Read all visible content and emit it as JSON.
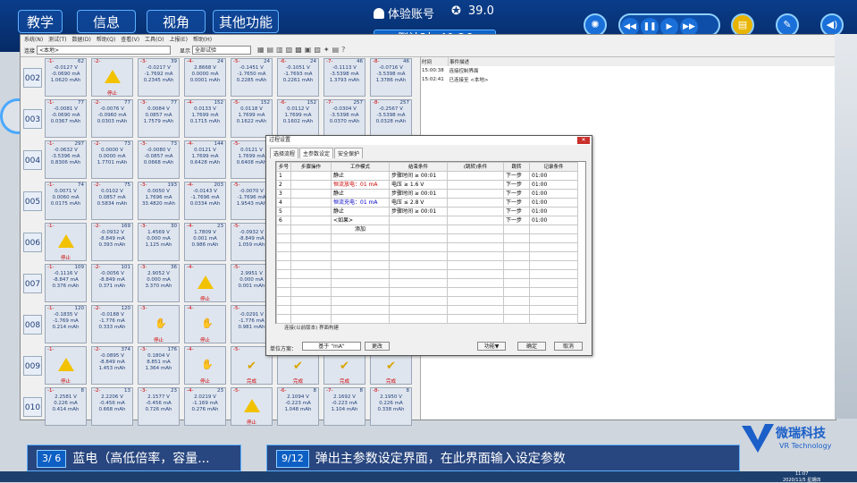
{
  "topbar": {
    "tabs": [
      "教学",
      "信息",
      "视角",
      "其他功能"
    ],
    "account": "体验账号",
    "score": "39.0",
    "timer": "倒计时: 40:26",
    "media": [
      "◀◀",
      "❚❚",
      "▶",
      "▶▶"
    ],
    "buttons": [
      "lightbulb-icon",
      "note-icon",
      "pen-icon",
      "speaker-icon"
    ]
  },
  "app": {
    "menu": [
      "系统(N)",
      "测试(T)",
      "数据(D)",
      "帮助(Q)",
      "查看(V)",
      "工具(O)",
      "上报(E)",
      "帮助(H)"
    ],
    "toolbar": {
      "connect_label": "连接",
      "connect_value": "<本地>",
      "display_label": "显示",
      "display_value": "全部试验"
    },
    "rows": [
      {
        "label": "002",
        "cells": [
          {
            "t": "data",
            "n": "-1-",
            "i": "62",
            "l": [
              "-0.0127 V",
              "-0.0690 mA",
              "1.0620 mAh"
            ]
          },
          {
            "t": "warn",
            "n": "-2-",
            "s": "停止"
          },
          {
            "t": "data",
            "n": "-3-",
            "i": "39",
            "l": [
              "-0.0217 V",
              "-1.7692 mA",
              "0.2345 mAh"
            ]
          },
          {
            "t": "data",
            "n": "-4-",
            "i": "24",
            "l": [
              "2.8668 V",
              "0.0000 mA",
              "0.0001 mAh"
            ]
          },
          {
            "t": "data",
            "n": "-5-",
            "i": "24",
            "l": [
              "-0.1451 V",
              "-1.7650 mA",
              "0.2285 mAh"
            ]
          },
          {
            "t": "data",
            "n": "-6-",
            "i": "24",
            "l": [
              "-0.1051 V",
              "-1.7693 mA",
              "0.2261 mAh"
            ]
          },
          {
            "t": "data",
            "n": "-7-",
            "i": "46",
            "l": [
              "-0.1113 V",
              "-3.5398 mA",
              "1.3793 mAh"
            ]
          },
          {
            "t": "data",
            "n": "-8-",
            "i": "46",
            "l": [
              "-0.0716 V",
              "-3.5398 mA",
              "1.3786 mAh"
            ]
          }
        ]
      },
      {
        "label": "003",
        "cells": [
          {
            "t": "data",
            "n": "-1-",
            "i": "77",
            "l": [
              "-0.0081 V",
              "-0.0690 mA",
              "0.0367 mAh"
            ]
          },
          {
            "t": "data",
            "n": "-2-",
            "i": "77",
            "l": [
              "-0.0076 V",
              "-0.0960 mA",
              "0.0303 mAh"
            ]
          },
          {
            "t": "data",
            "n": "-3-",
            "i": "77",
            "l": [
              "0.0084 V",
              "0.0857 mA",
              "1.7579 mAh"
            ]
          },
          {
            "t": "data",
            "n": "-4-",
            "i": "152",
            "l": [
              "0.0133 V",
              "1.7699 mA",
              "0.1715 mAh"
            ]
          },
          {
            "t": "data",
            "n": "-5-",
            "i": "152",
            "l": [
              "0.0118 V",
              "1.7699 mA",
              "0.1622 mAh"
            ]
          },
          {
            "t": "data",
            "n": "-6-",
            "i": "152",
            "l": [
              "0.0112 V",
              "1.7699 mA",
              "0.1602 mAh"
            ]
          },
          {
            "t": "data",
            "n": "-7-",
            "i": "257",
            "l": [
              "-0.0304 V",
              "-3.5398 mA",
              "0.0370 mAh"
            ]
          },
          {
            "t": "data",
            "n": "-8-",
            "i": "257",
            "l": [
              "-0.2567 V",
              "-3.5398 mA",
              "0.0328 mAh"
            ]
          }
        ]
      },
      {
        "label": "004",
        "cells": [
          {
            "t": "data",
            "n": "-1-",
            "i": "297",
            "l": [
              "-0.0632 V",
              "-3.5396 mA",
              "0.8306 mAh"
            ]
          },
          {
            "t": "data",
            "n": "-2-",
            "i": "73",
            "l": [
              "0.0000 V",
              "0.0000 mA",
              "1.7701 mAh"
            ]
          },
          {
            "t": "data",
            "n": "-3-",
            "i": "73",
            "l": [
              "-0.0080 V",
              "-0.0857 mA",
              "0.0668 mAh"
            ]
          },
          {
            "t": "data",
            "n": "-4-",
            "i": "144",
            "l": [
              "0.0121 V",
              "1.7699 mA",
              "0.6428 mAh"
            ]
          },
          {
            "t": "data",
            "n": "-5-",
            "i": "",
            "l": [
              "0.0121 V",
              "1.7699 mA",
              "0.6408 mAh"
            ]
          }
        ]
      },
      {
        "label": "005",
        "cells": [
          {
            "t": "data",
            "n": "-1-",
            "i": "74",
            "l": [
              "0.0071 V",
              "0.0060 mA",
              "0.0175 mAh"
            ]
          },
          {
            "t": "data",
            "n": "-2-",
            "i": "75",
            "l": [
              "0.0102 V",
              "0.0857 mA",
              "0.5834 mAh"
            ]
          },
          {
            "t": "data",
            "n": "-3-",
            "i": "193",
            "l": [
              "0.0050 V",
              "1.7696 mA",
              "33.4820 mAh"
            ]
          },
          {
            "t": "data",
            "n": "-4-",
            "i": "203",
            "l": [
              "-0.0143 V",
              "-1.7696 mA",
              "0.0334 mAh"
            ]
          },
          {
            "t": "data",
            "n": "-5-",
            "i": "",
            "l": [
              "-0.0070 V",
              "-1.7696 mA",
              "1.9543 mAh"
            ]
          }
        ]
      },
      {
        "label": "006",
        "cells": [
          {
            "t": "warn",
            "n": "-1-",
            "s": "停止"
          },
          {
            "t": "data",
            "n": "-2-",
            "i": "169",
            "l": [
              "-0.0932 V",
              "-8.849 mA",
              "0.393 mAh"
            ]
          },
          {
            "t": "data",
            "n": "-3-",
            "i": "30",
            "l": [
              "1.4569 V",
              "0.000 mA",
              "1.125 mAh"
            ]
          },
          {
            "t": "data",
            "n": "-4-",
            "i": "23",
            "l": [
              "1.7809 V",
              "0.001 mA",
              "0.986 mAh"
            ]
          },
          {
            "t": "data",
            "n": "-5-",
            "i": "",
            "l": [
              "-0.0932 V",
              "-8.849 mA",
              "1.059 mAh"
            ]
          }
        ]
      },
      {
        "label": "007",
        "cells": [
          {
            "t": "data",
            "n": "-1-",
            "i": "109",
            "l": [
              "-0.1116 V",
              "-8.847 mA",
              "0.376 mAh"
            ]
          },
          {
            "t": "data",
            "n": "-2-",
            "i": "101",
            "l": [
              "-0.0056 V",
              "-8.849 mA",
              "0.371 mAh"
            ]
          },
          {
            "t": "data",
            "n": "-3-",
            "i": "36",
            "l": [
              "2.9052 V",
              "0.000 mA",
              "3.370 mAh"
            ]
          },
          {
            "t": "warn",
            "n": "-4-",
            "s": "停止"
          },
          {
            "t": "data",
            "n": "-5-",
            "i": "",
            "l": [
              "2.9951 V",
              "0.000 mA",
              "0.001 mAh"
            ]
          }
        ]
      },
      {
        "label": "008",
        "cells": [
          {
            "t": "data",
            "n": "-1-",
            "i": "120",
            "l": [
              "-0.1835 V",
              "-1.769 mA",
              "0.214 mAh"
            ]
          },
          {
            "t": "data",
            "n": "-2-",
            "i": "120",
            "l": [
              "-0.0188 V",
              "-1.776 mA",
              "0.333 mAh"
            ]
          },
          {
            "t": "hand",
            "n": "-3-",
            "s": "停止"
          },
          {
            "t": "hand",
            "n": "-4-",
            "s": "停止"
          },
          {
            "t": "data",
            "n": "-5-",
            "i": "",
            "l": [
              "-0.0291 V",
              "-1.776 mA",
              "0.981 mAh"
            ]
          }
        ]
      },
      {
        "label": "009",
        "cells": [
          {
            "t": "warn",
            "n": "-1-",
            "s": "停止"
          },
          {
            "t": "data",
            "n": "-2-",
            "i": "374",
            "l": [
              "-0.0895 V",
              "-8.849 mA",
              "1.453 mAh"
            ]
          },
          {
            "t": "data",
            "n": "-3-",
            "i": "176",
            "l": [
              "0.1804 V",
              "8.851 mA",
              "1.364 mAh"
            ]
          },
          {
            "t": "hand",
            "n": "-4-",
            "s": "停止"
          },
          {
            "t": "done",
            "n": "-5-",
            "s": "完成"
          },
          {
            "t": "done",
            "n": "-6-",
            "s": "完成"
          },
          {
            "t": "done",
            "n": "-7-",
            "s": "完成"
          },
          {
            "t": "done",
            "n": "-8-",
            "s": "完成"
          }
        ]
      },
      {
        "label": "010",
        "cells": [
          {
            "t": "data",
            "n": "-1-",
            "i": "8",
            "l": [
              "2.2581 V",
              "0.226 mA",
              "0.414 mAh"
            ]
          },
          {
            "t": "data",
            "n": "-2-",
            "i": "13",
            "l": [
              "2.2206 V",
              "-0.456 mA",
              "0.668 mAh"
            ]
          },
          {
            "t": "data",
            "n": "-3-",
            "i": "23",
            "l": [
              "2.1577 V",
              "-0.456 mA",
              "0.726 mAh"
            ]
          },
          {
            "t": "data",
            "n": "-4-",
            "i": "23",
            "l": [
              "2.0219 V",
              "-1.169 mA",
              "0.276 mAh"
            ]
          },
          {
            "t": "warn",
            "n": "-5-",
            "s": "停止"
          },
          {
            "t": "data",
            "n": "-6-",
            "i": "8",
            "l": [
              "2.1094 V",
              "-0.223 mA",
              "1.048 mAh"
            ]
          },
          {
            "t": "data",
            "n": "-7-",
            "i": "8",
            "l": [
              "2.1692 V",
              "-0.223 mA",
              "1.104 mAh"
            ]
          },
          {
            "t": "data",
            "n": "-8-",
            "i": "8",
            "l": [
              "2.1950 V",
              "0.226 mA",
              "0.338 mAh"
            ]
          }
        ]
      }
    ],
    "log": {
      "headers": [
        "时间",
        "事件描述"
      ],
      "rows": [
        [
          "15:00:38",
          "连接控制界面"
        ],
        [
          "15:02:41",
          "已连接至 <本地>"
        ]
      ]
    }
  },
  "dialog": {
    "title": "过程设置",
    "close": "✕",
    "tabs": [
      "选择流程",
      "主参数设定",
      "安全保护"
    ],
    "headers": [
      "步号",
      "步骤操作",
      "工作模式",
      "结束条件",
      "(跳转)条件",
      "跳转",
      "记录条件"
    ],
    "rows": [
      [
        "1",
        "",
        "静止",
        "步骤时间 ≥ 00:01",
        "",
        "下一步",
        "01:00"
      ],
      [
        "2",
        "",
        "恒流放电：01 mA",
        "电压 ≥ 1.6 V",
        "",
        "下一步",
        "01:00"
      ],
      [
        "3",
        "",
        "静止",
        "步骤时间 ≥ 00:01",
        "",
        "下一步",
        "01:00"
      ],
      [
        "4",
        "",
        "恒流充电：01 mA",
        "电压 ≤ 2.8 V",
        "",
        "下一步",
        "01:00"
      ],
      [
        "5",
        "",
        "静止",
        "步骤时间 ≥ 00:01",
        "",
        "下一步",
        "01:00"
      ],
      [
        "6",
        "",
        "<如果>",
        "",
        "",
        "下一步",
        "01:00"
      ]
    ],
    "add_label": "添加",
    "bottom_note": "连接(以前版本) 界面构建",
    "unit_label": "单位方案：",
    "unit_value": "基于 \"mA\"",
    "change_btn": "更改",
    "func_btn": "功能▼",
    "ok_btn": "确定",
    "cancel_btn": "取消"
  },
  "captions": {
    "left_badge": "3/ 6",
    "left_text": "蓝电（高低倍率，容量...",
    "right_badge": "9/12",
    "right_text": "弹出主参数设定界面，在此界面输入设定参数"
  },
  "logo": {
    "cn": "微瑞科技",
    "en": "VR Technology"
  },
  "taskbar": {
    "time": "11:07",
    "date": "2020/11/5 星期四"
  }
}
